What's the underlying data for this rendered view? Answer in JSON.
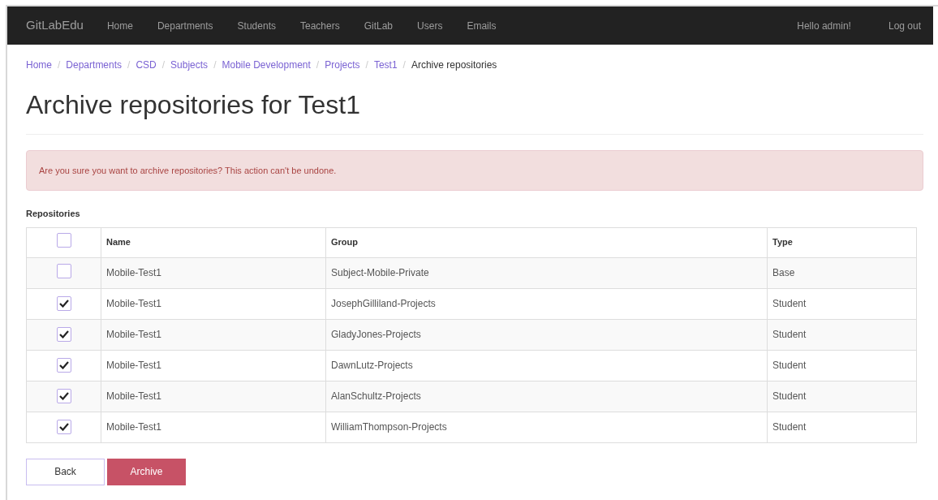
{
  "navbar": {
    "brand": "GitLabEdu",
    "links": [
      "Home",
      "Departments",
      "Students",
      "Teachers",
      "GitLab",
      "Users",
      "Emails"
    ],
    "greeting": "Hello admin!",
    "logout": "Log out"
  },
  "breadcrumb": {
    "links": [
      {
        "label": "Home",
        "separator": "/"
      },
      {
        "label": "Departments",
        "separator": "/"
      },
      {
        "label": "CSD",
        "separator": "/"
      },
      {
        "label": "Subjects",
        "separator": "/"
      },
      {
        "label": "Mobile Development",
        "separator": "/"
      },
      {
        "label": "Projects",
        "separator": "/"
      },
      {
        "label": "Test1",
        "separator": "/"
      }
    ],
    "current": "Archive repositories"
  },
  "title": "Archive repositories for Test1",
  "alert": "Are you sure you want to archive repositories? This action can't be undone.",
  "table": {
    "caption": "Repositories",
    "select_all": {
      "checked": false
    },
    "columns": [
      "Name",
      "Group",
      "Type"
    ],
    "rows": [
      {
        "checked": false,
        "cells": [
          "Mobile-Test1",
          "Subject-Mobile-Private",
          "Base"
        ]
      },
      {
        "checked": true,
        "cells": [
          "Mobile-Test1",
          "JosephGilliland-Projects",
          "Student"
        ]
      },
      {
        "checked": true,
        "cells": [
          "Mobile-Test1",
          "GladyJones-Projects",
          "Student"
        ]
      },
      {
        "checked": true,
        "cells": [
          "Mobile-Test1",
          "DawnLutz-Projects",
          "Student"
        ]
      },
      {
        "checked": true,
        "cells": [
          "Mobile-Test1",
          "AlanSchultz-Projects",
          "Student"
        ]
      },
      {
        "checked": true,
        "cells": [
          "Mobile-Test1",
          "WilliamThompson-Projects",
          "Student"
        ]
      }
    ]
  },
  "buttons": {
    "back": "Back",
    "archive": "Archive"
  }
}
